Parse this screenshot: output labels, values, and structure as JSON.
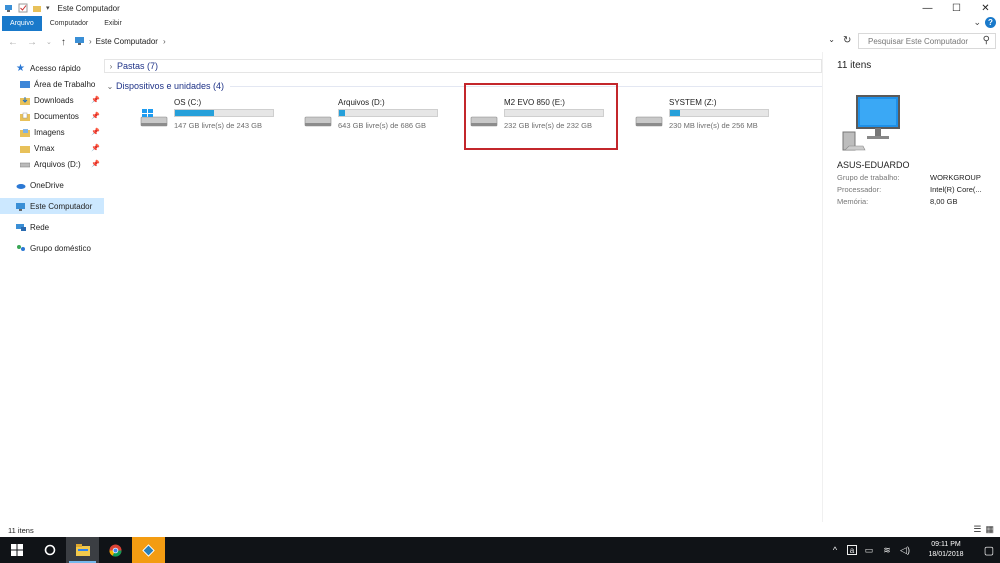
{
  "window": {
    "title": "Este Computador",
    "controls": {
      "minimize": "—",
      "maximize": "☐",
      "close": "✕"
    }
  },
  "ribbon": {
    "tabs": [
      "Arquivo",
      "Computador",
      "Exibir"
    ],
    "expand": "⌄",
    "help": "?"
  },
  "address": {
    "path": "Este Computador",
    "search_placeholder": "Pesquisar Este Computador"
  },
  "nav": {
    "quick_access": "Acesso rápido",
    "quick_items": [
      {
        "label": "Área de Trabalho"
      },
      {
        "label": "Downloads"
      },
      {
        "label": "Documentos"
      },
      {
        "label": "Imagens"
      },
      {
        "label": "Vmax"
      },
      {
        "label": "Arquivos (D:)"
      }
    ],
    "onedrive": "OneDrive",
    "this_pc": "Este Computador",
    "network": "Rede",
    "homegroup": "Grupo doméstico"
  },
  "content": {
    "folders_group": "Pastas (7)",
    "devices_group": "Dispositivos e unidades (4)",
    "drives": [
      {
        "name": "OS (C:)",
        "free": "147 GB livre(s) de 243 GB",
        "used_fraction": 0.4,
        "icon": "windows-drive-icon"
      },
      {
        "name": "Arquivos (D:)",
        "free": "643 GB livre(s) de 686 GB",
        "used_fraction": 0.06,
        "icon": "hard-drive-icon"
      },
      {
        "name": "M2 EVO 850 (E:)",
        "free": "232 GB livre(s) de 232 GB",
        "used_fraction": 0.0,
        "icon": "hard-drive-icon"
      },
      {
        "name": "SYSTEM (Z:)",
        "free": "230 MB livre(s) de 256 MB",
        "used_fraction": 0.1,
        "icon": "hard-drive-icon"
      }
    ]
  },
  "details": {
    "count": "11 itens",
    "computer_name": "ASUS-EDUARDO",
    "rows": [
      {
        "label": "Grupo de trabalho:",
        "value": "WORKGROUP"
      },
      {
        "label": "Processador:",
        "value": "Intel(R) Core(..."
      },
      {
        "label": "Memória:",
        "value": "8,00 GB"
      }
    ]
  },
  "status": {
    "count": "11 itens"
  },
  "taskbar": {
    "time": "09:11 PM",
    "date": "18/01/2018"
  },
  "colors": {
    "accent": "#1979ca",
    "bar_fill": "#26a0da",
    "highlight": "#c3262b",
    "taskbar": "#101317"
  }
}
